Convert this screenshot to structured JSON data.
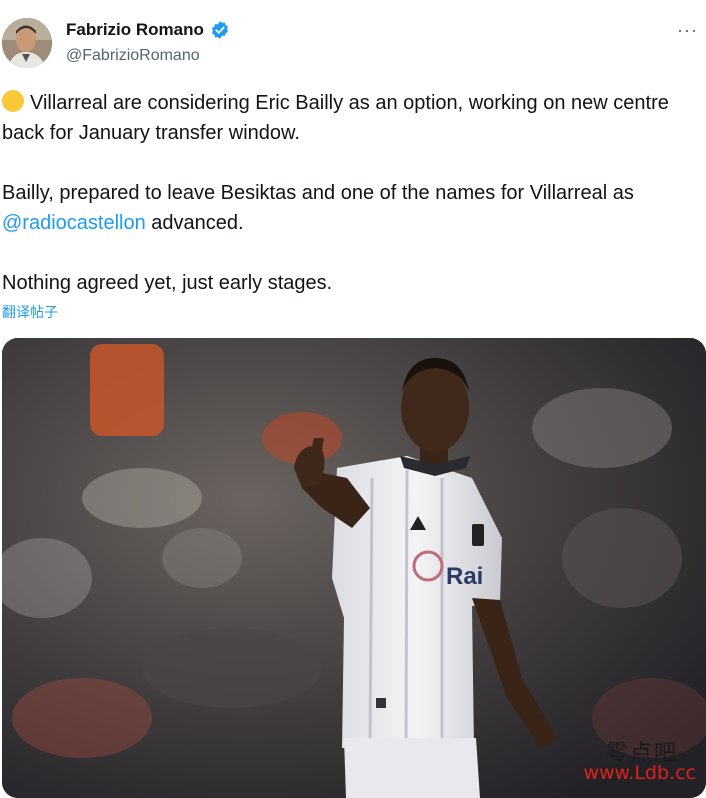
{
  "author": {
    "name": "Fabrizio Romano",
    "handle": "@FabrizioRomano",
    "verified_color": "#1d9bf0",
    "avatar_icon": "avatar"
  },
  "more_label": "···",
  "tweet": {
    "line1": "Villarreal are considering Eric Bailly as an option, working on new centre back for January transfer window.",
    "line2_before": "Bailly, prepared to leave Besiktas and one of the names for Villarreal as",
    "mention": "@radiocastellon",
    "line2_after": " advanced.",
    "line3": "Nothing agreed yet, just early stages."
  },
  "translate_label": "翻译帖子",
  "media": {
    "jersey_text": "Rai",
    "watermark_cn": "零点吧",
    "watermark_url": "www.Ldb.cc"
  },
  "colors": {
    "link": "#1d9bf0",
    "text": "#0f1419",
    "secondary": "#536471",
    "emoji": "#f8c838"
  }
}
